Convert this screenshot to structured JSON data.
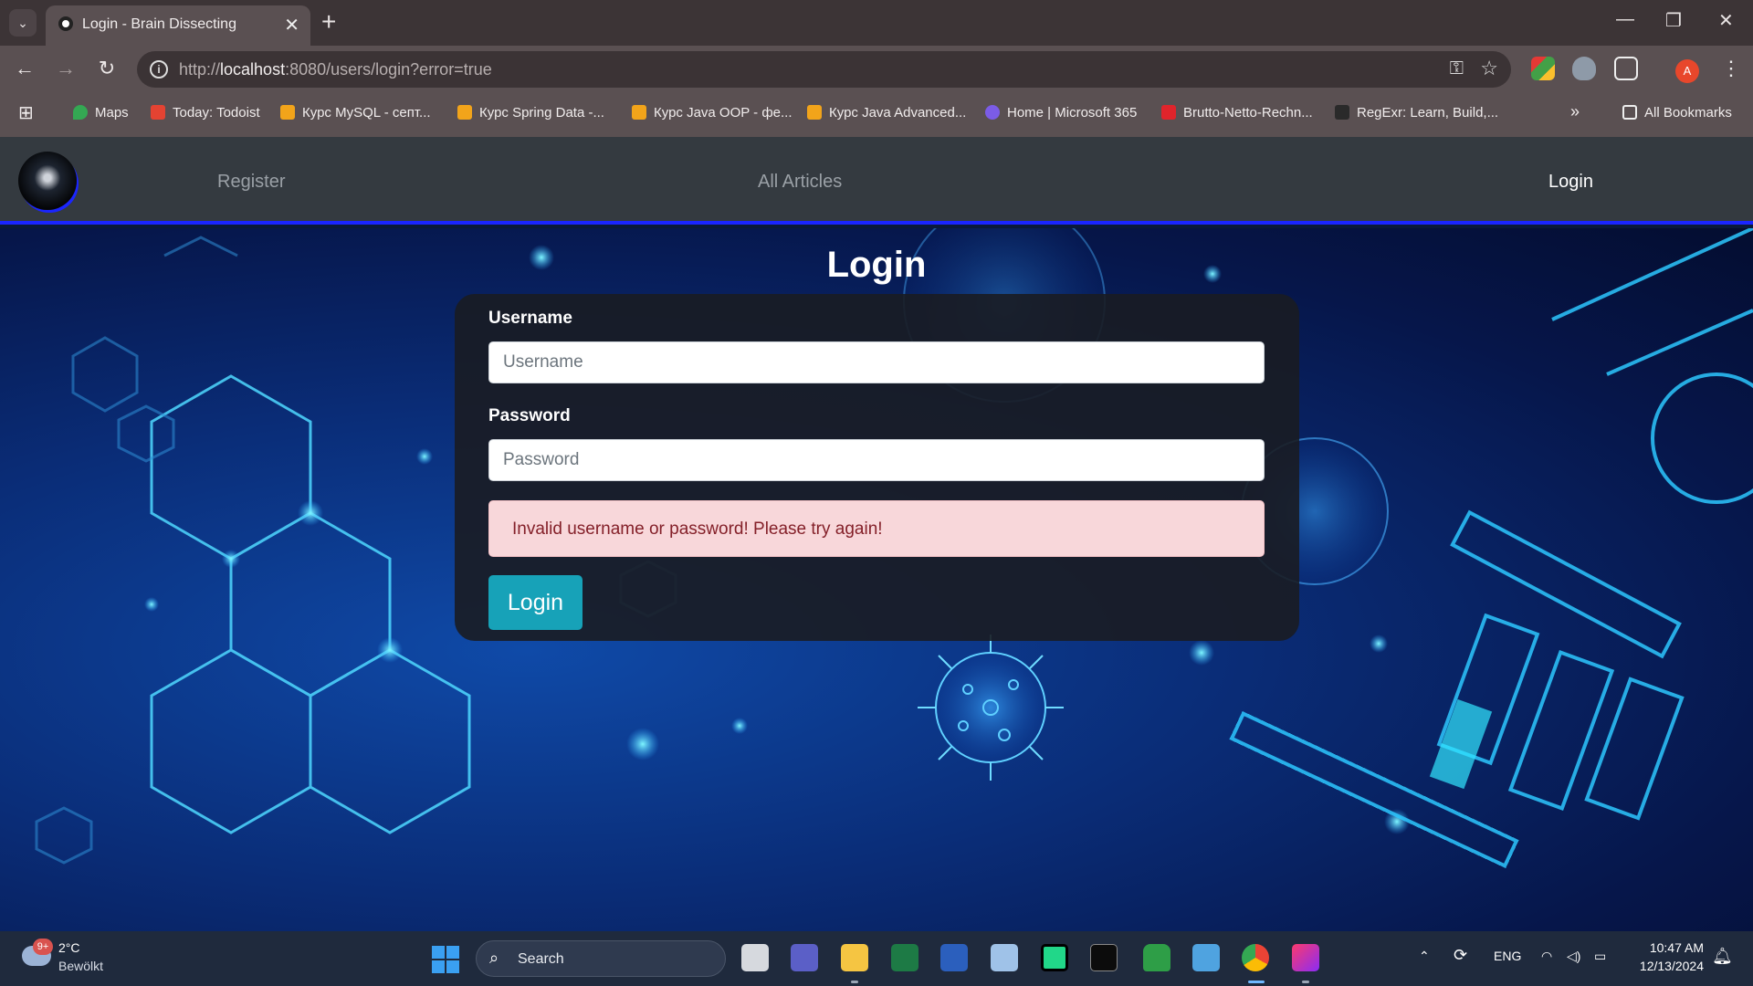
{
  "browser": {
    "tab_title": "Login - Brain Dissecting",
    "tab_close": "✕",
    "new_tab": "+",
    "url_prefix": "http://",
    "url_host": "localhost",
    "url_rest": ":8080/users/login?error=true",
    "profile_initial": "A",
    "bookmarks": [
      {
        "label": "Maps",
        "color": "#34a853"
      },
      {
        "label": "Today: Todoist",
        "color": "#e44332"
      },
      {
        "label": "Курс MySQL - септ...",
        "color": "#f2a41a"
      },
      {
        "label": "Курс Spring Data -...",
        "color": "#f2a41a"
      },
      {
        "label": "Курс Java OOP - фе...",
        "color": "#f2a41a"
      },
      {
        "label": "Курс Java Advanced...",
        "color": "#f2a41a"
      },
      {
        "label": "Home | Microsoft 365",
        "color": "#7b5ce6"
      },
      {
        "label": "Brutto-Netto-Rechn...",
        "color": "#e0242b"
      },
      {
        "label": "RegExr: Learn, Build,...",
        "color": "#2a2a2a"
      }
    ],
    "more_bookmarks": "»",
    "all_bookmarks": "All Bookmarks"
  },
  "site": {
    "nav": {
      "register": "Register",
      "all_articles": "All Articles",
      "login": "Login"
    },
    "page_title": "Login",
    "form": {
      "username_label": "Username",
      "username_placeholder": "Username",
      "password_label": "Password",
      "password_placeholder": "Password",
      "error_message": "Invalid username or password! Please try again!",
      "submit_label": "Login"
    }
  },
  "taskbar": {
    "weather_temp": "2°C",
    "weather_desc": "Bewölkt",
    "weather_badge": "9+",
    "search_label": "Search",
    "language": "ENG",
    "time": "10:47 AM",
    "date": "12/13/2024"
  },
  "colors": {
    "accent": "#17a2b8",
    "navbar_border": "#1a25ff",
    "alert_bg": "#f8d7da",
    "alert_text": "#842029"
  }
}
